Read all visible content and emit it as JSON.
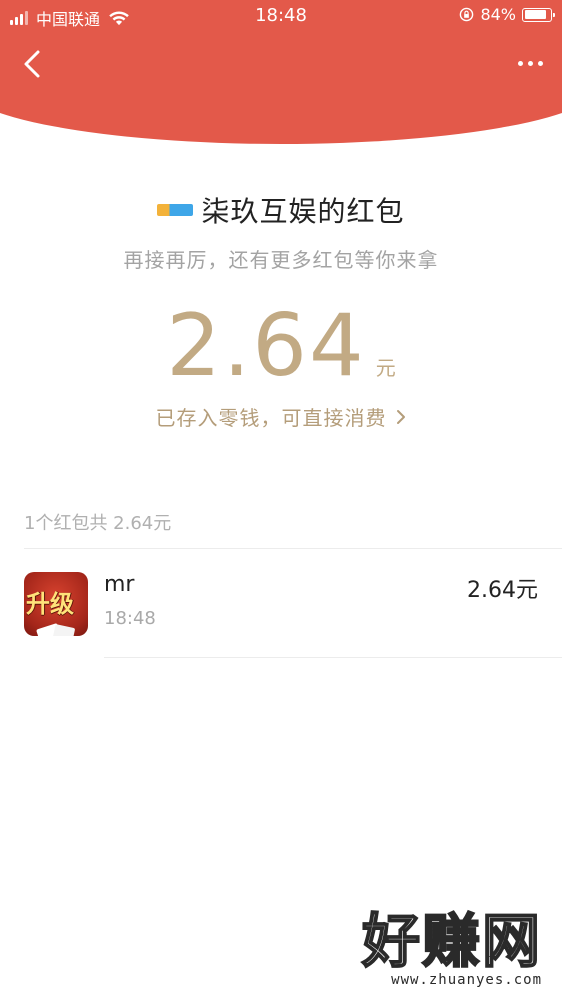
{
  "status_bar": {
    "carrier": "中国联通",
    "time": "18:48",
    "battery": "84%",
    "battery_level": 0.84,
    "icons": [
      "signal-icon",
      "wifi-icon",
      "rotation-lock-icon",
      "battery-icon"
    ]
  },
  "nav": {
    "back_icon": "chevron-left-icon",
    "more_icon": "more-dots-icon"
  },
  "packet": {
    "sender_name": "柒玖互娱的红包",
    "subtitle": "再接再厉，还有更多红包等你来拿",
    "amount": "2.64",
    "unit": "元",
    "stored_text": "已存入零钱，可直接消费"
  },
  "list": {
    "summary": "1个红包共 2.64元",
    "items": [
      {
        "name": "mr",
        "time": "18:48",
        "amount": "2.64元",
        "avatar_text": "升级"
      }
    ]
  },
  "watermark": {
    "big": "好赚网",
    "small": "www.zhuanyes.com"
  },
  "colors": {
    "header_red": "#e3594a",
    "gold": "#c2aa84",
    "text_dark": "#222222",
    "text_gray": "#a3a3a3"
  }
}
